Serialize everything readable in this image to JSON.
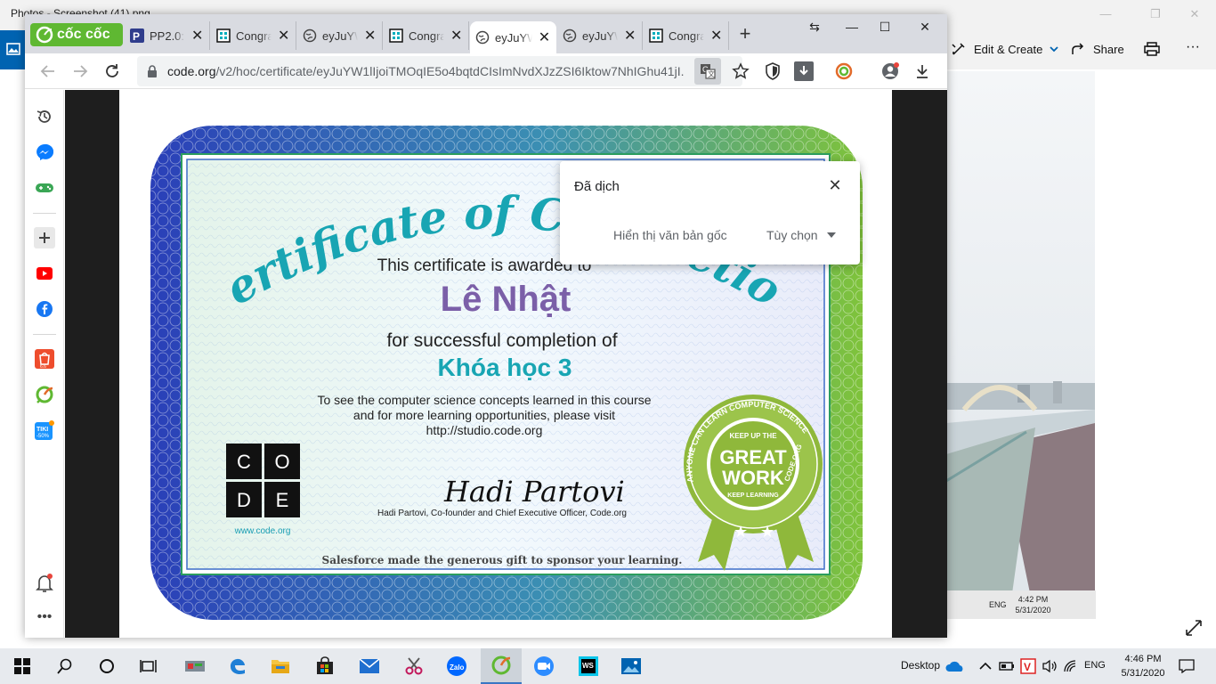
{
  "photos_app": {
    "title": "Photos - Screenshot (41).png",
    "edit_create_label": "Edit & Create",
    "share_label": "Share",
    "more_label": "···",
    "inner_clock_time": "4:42 PM",
    "inner_clock_date": "5/31/2020",
    "inner_lang": "ENG"
  },
  "browser": {
    "brand": "cốc cốc",
    "tabs": [
      {
        "label": "PP2.0:",
        "icon": "pp-favicon"
      },
      {
        "label": "Congratulations",
        "icon": "codeorg-favicon"
      },
      {
        "label": "eyJuYW",
        "icon": "globe-icon"
      },
      {
        "label": "Congratulations",
        "icon": "codeorg-favicon"
      },
      {
        "label": "eyJuYW",
        "icon": "globe-icon"
      },
      {
        "label": "eyJuYW",
        "icon": "globe-icon"
      },
      {
        "label": "Congratulations",
        "icon": "codeorg-favicon"
      }
    ],
    "url_host": "code.org",
    "url_path": "/v2/hoc/certificate/eyJuYW1lIjoiTMOqIE5o4bqtdCIsImNvdXJzZSI6Iktow7NhIGhu41jI..."
  },
  "translate_popup": {
    "title": "Đã dịch",
    "show_original": "Hiển thị văn bản gốc",
    "options": "Tùy chọn"
  },
  "certificate": {
    "heading": "Certificate of Completion",
    "awarded_line": "This certificate is awarded to",
    "recipient": "Lê Nhật",
    "completion_line": "for successful completion of",
    "course": "Khóa học 3",
    "visit_line1": "To see the computer science concepts learned in this course",
    "visit_line2": "and for more learning opportunities, please visit",
    "visit_url": "http://studio.code.org",
    "logo_letters": [
      "C",
      "O",
      "D",
      "E"
    ],
    "logo_url": "www.code.org",
    "signature": "Hadi Partovi",
    "signer_caption": "Hadi Partovi, Co-founder and Chief Executive Officer, Code.org",
    "sponsor_line": "Salesforce made the generous gift to sponsor your learning.",
    "badge_top": "KEEP UP THE",
    "badge_main1": "GREAT",
    "badge_main2": "WORK",
    "badge_bottom": "KEEP LEARNING",
    "badge_ring_left": "ANYONE CAN LEARN COMPUTER SCIENCE",
    "badge_ring_right": "CODE.ORG"
  },
  "taskbar": {
    "desktop_label": "Desktop",
    "lang": "ENG",
    "time": "4:46 PM",
    "date": "5/31/2020"
  },
  "colors": {
    "cert_teal": "#18a5b3",
    "recipient_purple": "#7b5fa8",
    "badge_green": "#8fb83b",
    "coccoc_green": "#5fb832"
  }
}
